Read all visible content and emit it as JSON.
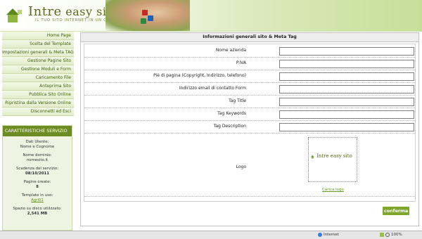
{
  "header": {
    "logo_part1": "Intre",
    "logo_part2": "easy sito",
    "tagline": "IL TUO SITO INTERNET IN UN CLICK!"
  },
  "sidebar": {
    "items": [
      {
        "label": "Home Page"
      },
      {
        "label": "Scelta del Template"
      },
      {
        "label": "Impostazioni generali & Meta TAG"
      },
      {
        "label": "Gestione Pagine Sito"
      },
      {
        "label": "Gestione Moduli e Form"
      },
      {
        "label": "Caricamento File"
      },
      {
        "label": "Anteprima Sito"
      },
      {
        "label": "Pubblica Sito Online"
      },
      {
        "label": "Ripristina dalla Versione Online"
      },
      {
        "label": "Disconnetti ed Esci"
      }
    ]
  },
  "service": {
    "title": "CARATTERISTICHE SERVIZIO",
    "user_label": "Dati Utente:",
    "user_value": "Nome e Cognome",
    "domain_label": "Nome dominio:",
    "domain_value": "nomesito.it",
    "expiry_label": "Scadenza del servizio:",
    "expiry_value": "08/10/2011",
    "pages_label": "Pagine create:",
    "pages_value": "8",
    "template_label": "Template in uso:",
    "template_value": "Agri01",
    "disk_label": "Spazio su disco utilizzato:",
    "disk_value": "2,541 MB"
  },
  "panel": {
    "title": "Informazioni generali sito & Meta Tag",
    "fields": [
      {
        "label": "Nome azienda",
        "value": ""
      },
      {
        "label": "P.IVA",
        "value": ""
      },
      {
        "label": "Piè di pagina (Copyright, Indirizzo, telefono)",
        "value": ""
      },
      {
        "label": "Indirizzo email di contatto Form",
        "value": ""
      },
      {
        "label": "Tag Title",
        "value": ""
      },
      {
        "label": "Tag Keywords",
        "value": ""
      },
      {
        "label": "Tag Description",
        "value": ""
      }
    ],
    "logo_label": "Logo",
    "logo_preview_text": "Intre easy sito",
    "upload_link": "Carica logo",
    "confirm_label": "conferma"
  },
  "statusbar": {
    "zone": "Internet",
    "zoom": "100%"
  },
  "colors": {
    "accent": "#7ea62b",
    "sidebar_text": "#3d5c0c",
    "header_green": "#c6df98"
  }
}
